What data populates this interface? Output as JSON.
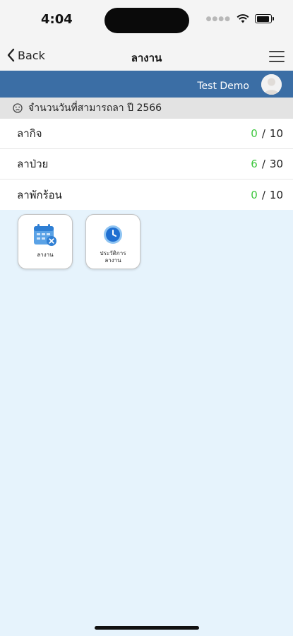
{
  "status_bar": {
    "time": "4:04"
  },
  "nav": {
    "back_label": "Back",
    "title": "ลางาน"
  },
  "user": {
    "name": "Test Demo"
  },
  "summary": {
    "title": "จำนวนวันที่สามารถลา ปี 2566"
  },
  "leave_types": [
    {
      "label": "ลากิจ",
      "used": "0",
      "total": "10"
    },
    {
      "label": "ลาป่วย",
      "used": "6",
      "total": "30"
    },
    {
      "label": "ลาพักร้อน",
      "used": "0",
      "total": "10"
    }
  ],
  "apps": [
    {
      "label": "ลางาน",
      "icon": "calendar-cancel-icon"
    },
    {
      "label_line1": "ประวัติการ",
      "label_line2": "ลางาน",
      "icon": "clock-icon"
    }
  ],
  "colors": {
    "header_blue": "#3b6ea5",
    "used_green": "#3cc63c",
    "background": "#e6f3fc"
  }
}
